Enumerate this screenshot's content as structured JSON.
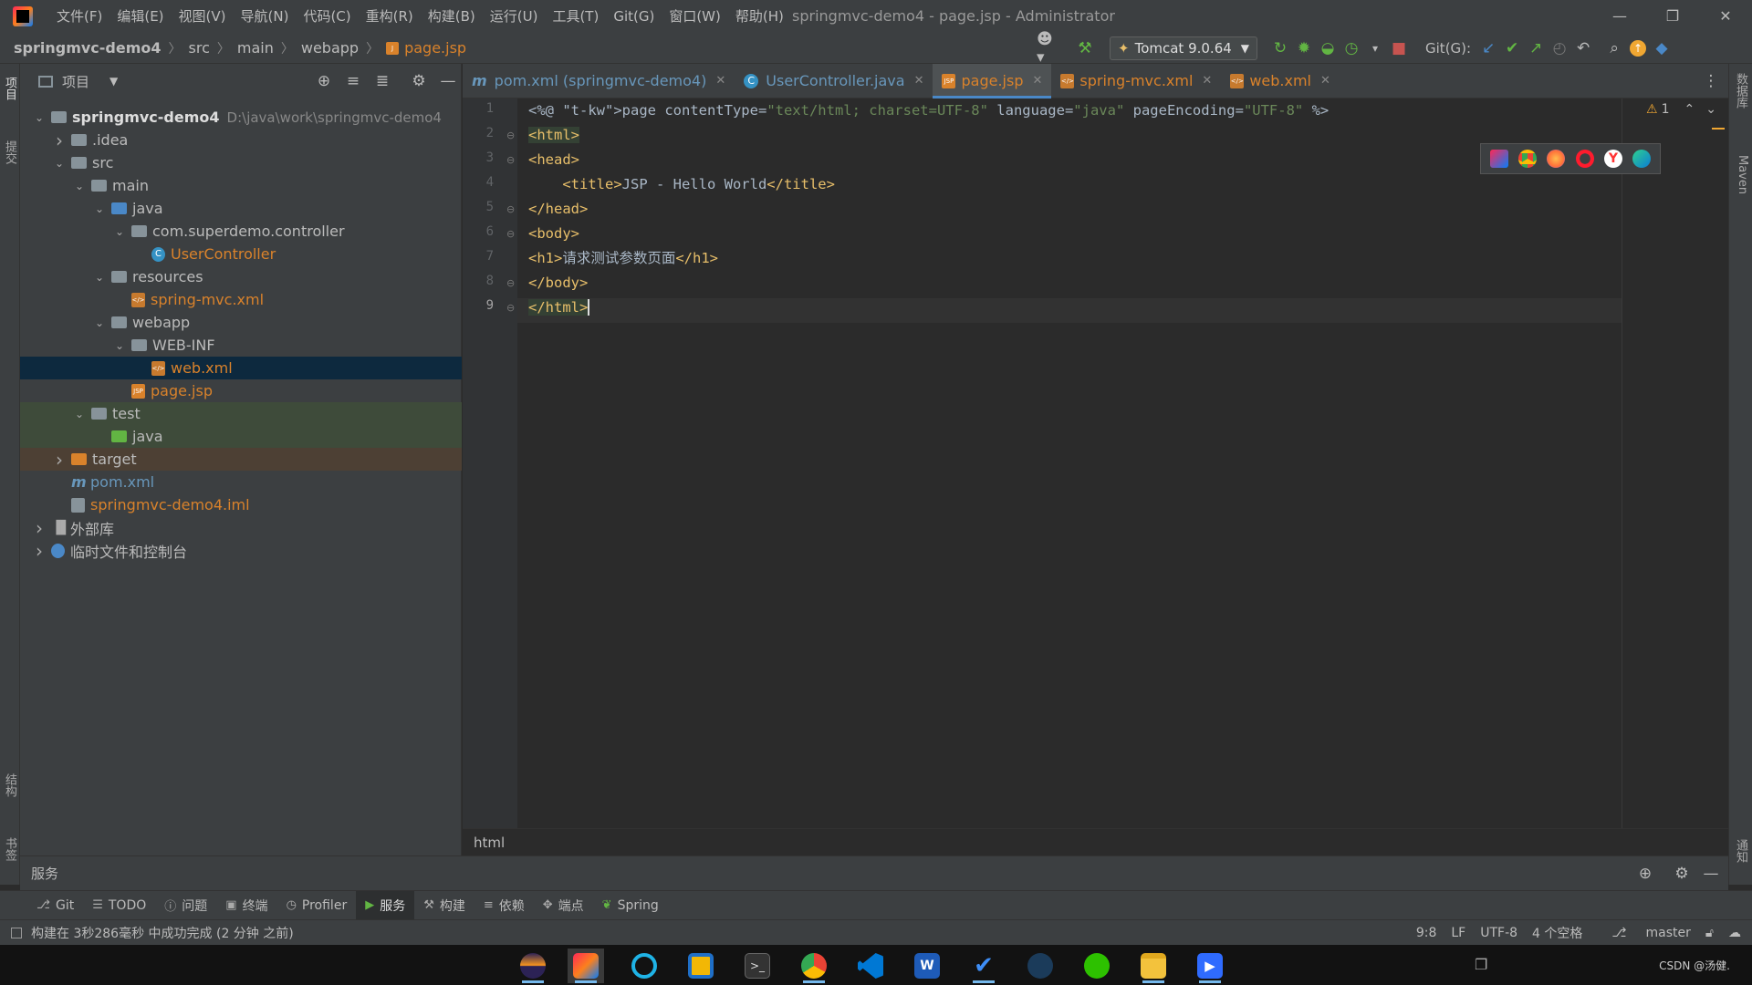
{
  "window": {
    "title": "springmvc-demo4 - page.jsp - Administrator",
    "menu": [
      "文件(F)",
      "编辑(E)",
      "视图(V)",
      "导航(N)",
      "代码(C)",
      "重构(R)",
      "构建(B)",
      "运行(U)",
      "工具(T)",
      "Git(G)",
      "窗口(W)",
      "帮助(H)"
    ],
    "controls": [
      "minimize",
      "restore",
      "close"
    ]
  },
  "nav": {
    "breadcrumbs": [
      "springmvc-demo4",
      "src",
      "main",
      "webapp",
      "page.jsp"
    ],
    "run_config": "Tomcat 9.0.64",
    "git_label": "Git(G):"
  },
  "project_panel": {
    "title": "项目",
    "tree": [
      {
        "label": "springmvc-demo4",
        "path": "D:\\java\\work\\springmvc-demo4",
        "depth": 0,
        "arrow": "down",
        "kind": "module"
      },
      {
        "label": ".idea",
        "depth": 1,
        "arrow": "right",
        "kind": "folder"
      },
      {
        "label": "src",
        "depth": 1,
        "arrow": "down",
        "kind": "folder"
      },
      {
        "label": "main",
        "depth": 2,
        "arrow": "down",
        "kind": "folder"
      },
      {
        "label": "java",
        "depth": 3,
        "arrow": "down",
        "kind": "folder-blue"
      },
      {
        "label": "com.superdemo.controller",
        "depth": 4,
        "arrow": "down",
        "kind": "package"
      },
      {
        "label": "UserController",
        "depth": 5,
        "arrow": "",
        "kind": "class"
      },
      {
        "label": "resources",
        "depth": 3,
        "arrow": "down",
        "kind": "folder-res"
      },
      {
        "label": "spring-mvc.xml",
        "depth": 4,
        "arrow": "",
        "kind": "xml"
      },
      {
        "label": "webapp",
        "depth": 3,
        "arrow": "down",
        "kind": "folder-web"
      },
      {
        "label": "WEB-INF",
        "depth": 4,
        "arrow": "down",
        "kind": "folder"
      },
      {
        "label": "web.xml",
        "depth": 5,
        "arrow": "",
        "kind": "xml",
        "selected": true
      },
      {
        "label": "page.jsp",
        "depth": 4,
        "arrow": "",
        "kind": "jsp"
      },
      {
        "label": "test",
        "depth": 2,
        "arrow": "down",
        "kind": "folder",
        "band": "green"
      },
      {
        "label": "java",
        "depth": 3,
        "arrow": "",
        "kind": "folder-green",
        "band": "green"
      },
      {
        "label": "target",
        "depth": 1,
        "arrow": "right",
        "kind": "folder-orange",
        "band": "orange"
      },
      {
        "label": "pom.xml",
        "depth": 1,
        "arrow": "",
        "kind": "maven"
      },
      {
        "label": "springmvc-demo4.iml",
        "depth": 1,
        "arrow": "",
        "kind": "iml"
      },
      {
        "label": "外部库",
        "depth": 0,
        "arrow": "right",
        "kind": "libs"
      },
      {
        "label": "临时文件和控制台",
        "depth": 0,
        "arrow": "right",
        "kind": "scratch"
      }
    ]
  },
  "left_stripe": [
    "项目",
    "提交",
    "结构",
    "书签"
  ],
  "right_stripe": [
    "数据库",
    "Maven",
    "通知"
  ],
  "editor": {
    "tabs": [
      {
        "label": "pom.xml (springmvc-demo4)",
        "icon": "m",
        "color": "#6897bb"
      },
      {
        "label": "UserController.java",
        "icon": "C",
        "color": "#6897bb"
      },
      {
        "label": "page.jsp",
        "icon": "jsp",
        "color": "#d9822b",
        "active": true
      },
      {
        "label": "spring-mvc.xml",
        "icon": "xml",
        "color": "#d9822b"
      },
      {
        "label": "web.xml",
        "icon": "xml",
        "color": "#d9822b"
      }
    ],
    "line_numbers": [
      "1",
      "2",
      "3",
      "4",
      "5",
      "6",
      "7",
      "8",
      "9"
    ],
    "lines": [
      "<%@ page contentType=\"text/html; charset=UTF-8\" language=\"java\" pageEncoding=\"UTF-8\" %>",
      "<html>",
      "<head>",
      "    <title>JSP - Hello World</title>",
      "</head>",
      "<body>",
      "<h1>请求测试参数页面</h1>",
      "</body>",
      "</html>"
    ],
    "warning_count": "1",
    "breadcrumb": "html"
  },
  "services_panel": {
    "title": "服务"
  },
  "tool_tabs": [
    {
      "label": "Git",
      "icon": "branch"
    },
    {
      "label": "TODO",
      "icon": "list"
    },
    {
      "label": "问题",
      "icon": "info"
    },
    {
      "label": "终端",
      "icon": "terminal"
    },
    {
      "label": "Profiler",
      "icon": "profiler"
    },
    {
      "label": "服务",
      "icon": "services",
      "active": true
    },
    {
      "label": "构建",
      "icon": "hammer"
    },
    {
      "label": "依赖",
      "icon": "layers"
    },
    {
      "label": "端点",
      "icon": "endpoints"
    },
    {
      "label": "Spring",
      "icon": "spring"
    }
  ],
  "status": {
    "message": "构建在 3秒286毫秒 中成功完成 (2 分钟 之前)",
    "position": "9:8",
    "line_sep": "LF",
    "encoding": "UTF-8",
    "indent": "4 个空格",
    "branch": "master"
  },
  "taskbar": {
    "apps": [
      "eclipse",
      "intellij",
      "edge-beta",
      "virtualbox",
      "terminal",
      "chrome",
      "vscode",
      "word",
      "todo",
      "steam",
      "wechat",
      "explorer",
      "player"
    ],
    "watermark": "CSDN @汤健."
  },
  "colors": {
    "accent": "#4a88c7",
    "selection": "#0d293e",
    "test_band": "#3e4b3a",
    "target_band": "#4d4034"
  }
}
